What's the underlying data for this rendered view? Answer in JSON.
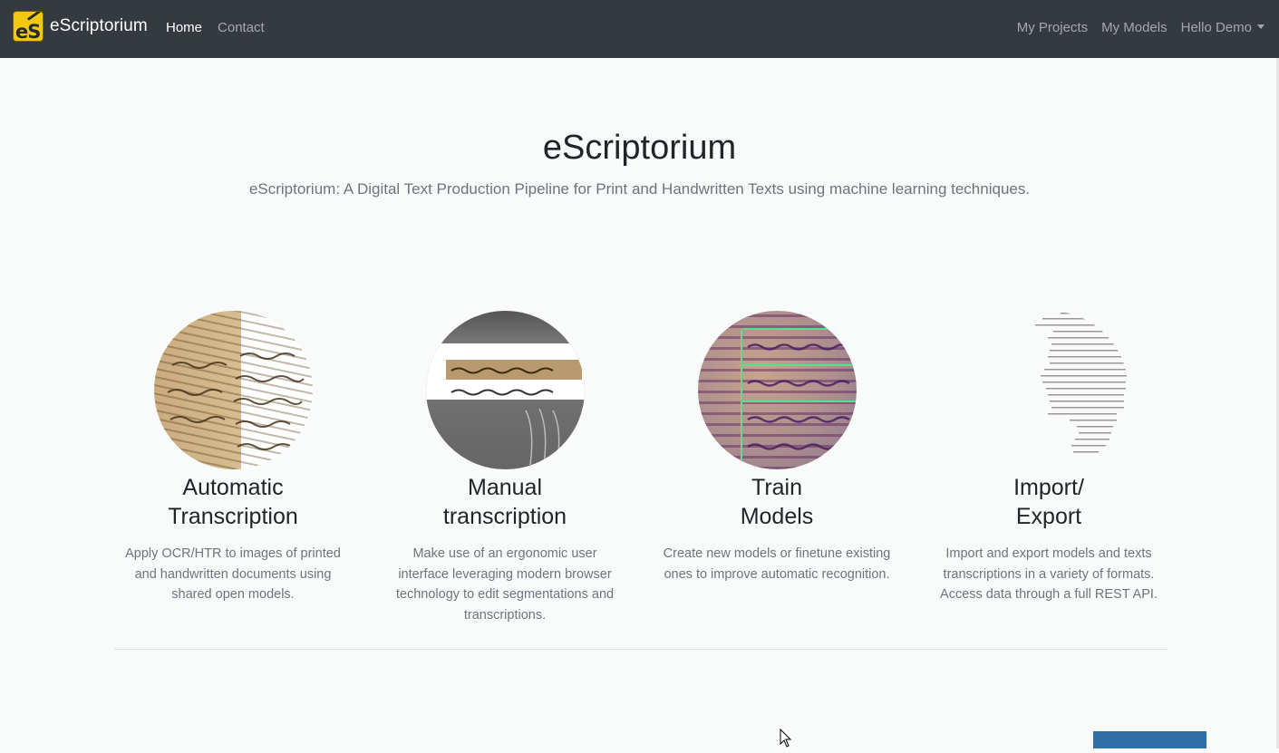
{
  "nav": {
    "brand": "eScriptorium",
    "left": [
      "Home",
      "Contact"
    ],
    "right": [
      "My Projects",
      "My Models",
      "Hello Demo"
    ]
  },
  "hero": {
    "title": "eScriptorium",
    "subtitle": "eScriptorium: A Digital Text Production Pipeline for Print and Handwritten Texts using machine learning techniques."
  },
  "features": [
    {
      "title_line1": "Automatic",
      "title_line2": "Transcription",
      "text": "Apply OCR/HTR to images of printed and handwritten documents using shared open models."
    },
    {
      "title_line1": "Manual",
      "title_line2": "transcription",
      "text": "Make use of an ergonomic user interface leveraging modern browser technology to edit segmentations and transcriptions."
    },
    {
      "title_line1": "Train",
      "title_line2": "Models",
      "text": "Create new models or finetune existing ones to improve automatic recognition."
    },
    {
      "title_line1": "Import/",
      "title_line2": "Export",
      "text": "Import and export models and texts transcriptions in a variety of formats. Access data through a full REST API."
    }
  ],
  "colors": {
    "navbar": "#343a40",
    "accent_logo": "#f2c811",
    "muted": "#6c757d"
  },
  "icons": [
    "escriptorium-logo-icon",
    "dropdown-caret-icon",
    "mouse-cursor-icon"
  ]
}
